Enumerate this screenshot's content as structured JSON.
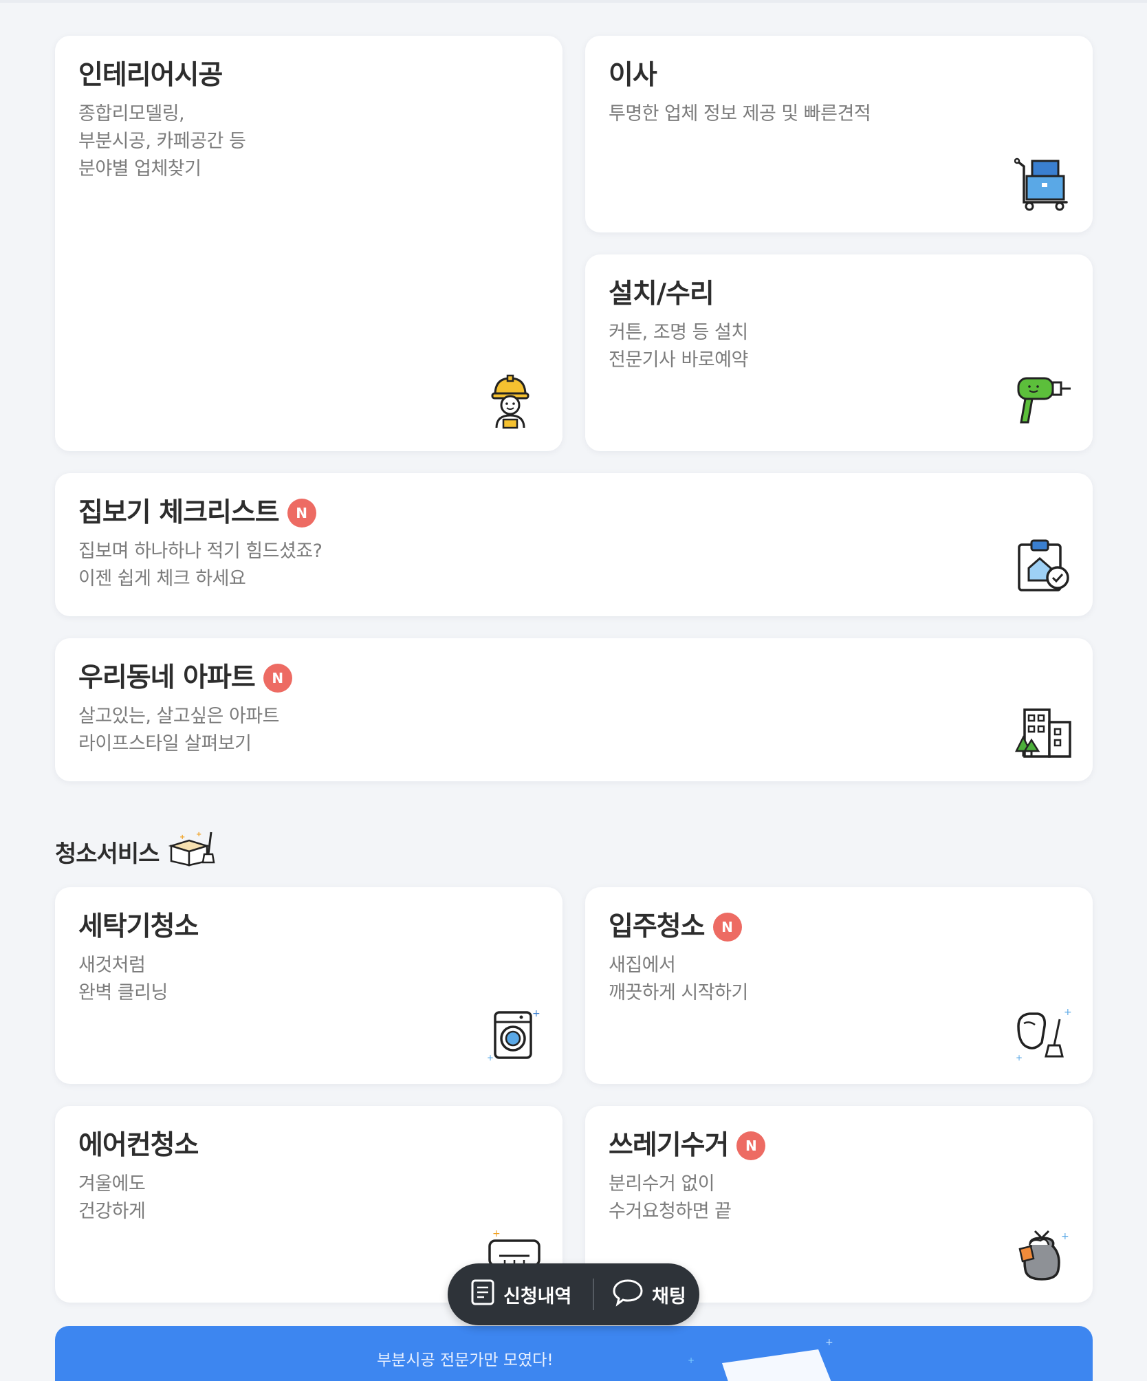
{
  "cards": {
    "interior": {
      "title": "인테리어시공",
      "desc": "종합리모델링,\n부분시공, 카페공간 등\n분야별 업체찾기",
      "icon": "construction-worker-icon"
    },
    "moving": {
      "title": "이사",
      "desc": "투명한 업체 정보 제공 및 빠른견적",
      "icon": "moving-cart-icon"
    },
    "install": {
      "title": "설치/수리",
      "desc": "커튼, 조명 등 설치\n전문기사 바로예약",
      "icon": "drill-icon"
    },
    "checklist": {
      "title": "집보기 체크리스트",
      "badge": "N",
      "desc": "집보며 하나하나 적기 힘드셨죠?\n이젠 쉽게 체크 하세요",
      "icon": "clipboard-check-icon"
    },
    "apartment": {
      "title": "우리동네 아파트",
      "badge": "N",
      "desc": "살고있는, 살고싶은 아파트\n라이프스타일 살펴보기",
      "icon": "apartment-building-icon"
    },
    "washer": {
      "title": "세탁기청소",
      "desc": "새것처럼\n완벽 클리닝",
      "icon": "washing-machine-icon"
    },
    "movein": {
      "title": "입주청소",
      "badge": "N",
      "desc": "새집에서\n깨끗하게 시작하기",
      "icon": "cleaning-glove-icon"
    },
    "aircon": {
      "title": "에어컨청소",
      "desc": "겨울에도\n건강하게",
      "icon": "air-conditioner-icon"
    },
    "trash": {
      "title": "쓰레기수거",
      "badge": "N",
      "desc": "분리수거 없이\n수거요청하면 끝",
      "icon": "trash-bag-icon"
    }
  },
  "section": {
    "title": "청소서비스",
    "icon": "cleaning-box-icon"
  },
  "floatbar": {
    "history_label": "신청내역",
    "chat_label": "채팅"
  },
  "banner": {
    "text": "부분시공 전문가만 모였다!"
  },
  "colors": {
    "badge": "#ed6b63",
    "banner": "#3d86f0",
    "floatbar": "#2e3339"
  }
}
